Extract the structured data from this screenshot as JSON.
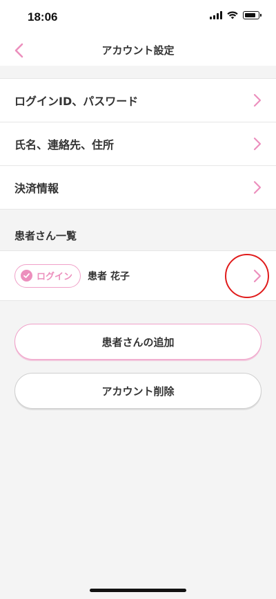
{
  "status": {
    "time": "18:06"
  },
  "nav": {
    "title": "アカウント設定"
  },
  "settings": {
    "items": [
      {
        "label": "ログインID、パスワード"
      },
      {
        "label": "氏名、連絡先、住所"
      },
      {
        "label": "決済情報"
      }
    ]
  },
  "patients": {
    "header": "患者さん一覧",
    "items": [
      {
        "badge": "ログイン",
        "name": "患者 花子"
      }
    ]
  },
  "buttons": {
    "add_patient": "患者さんの追加",
    "delete_account": "アカウント削除"
  },
  "colors": {
    "accent_pink": "#ec8fbd",
    "highlight_red": "#e01b1b"
  }
}
